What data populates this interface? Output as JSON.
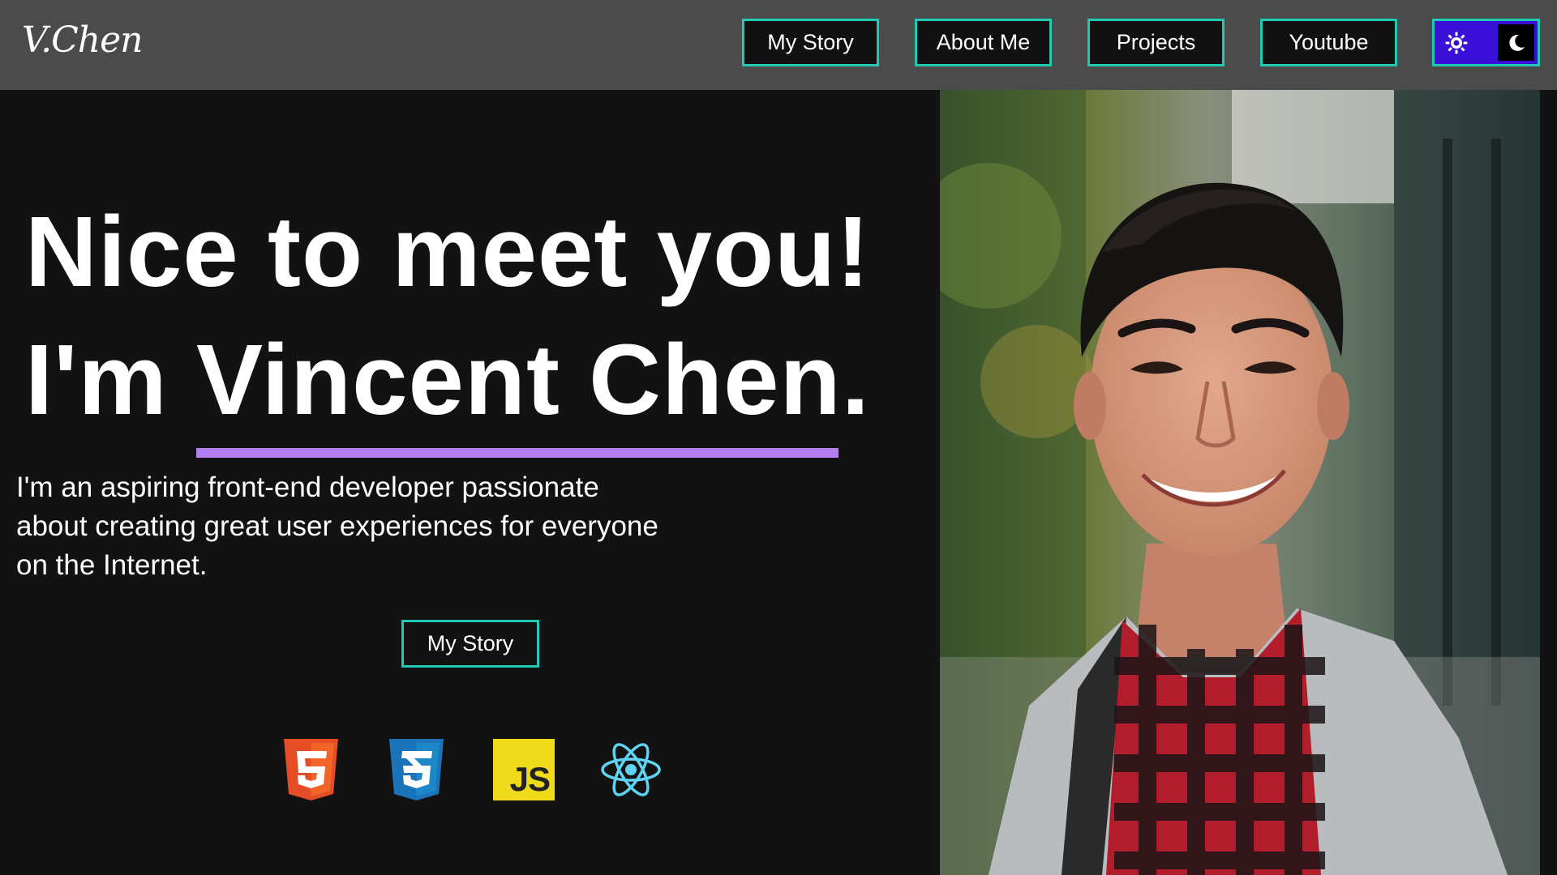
{
  "header": {
    "logo": "V.Chen",
    "nav": [
      {
        "label": "My Story"
      },
      {
        "label": "About Me"
      },
      {
        "label": "Projects"
      },
      {
        "label": "Youtube"
      }
    ],
    "theme_toggle": {
      "light_icon": "sun-icon",
      "dark_icon": "moon-icon",
      "state": "dark"
    }
  },
  "hero": {
    "line1": "Nice to meet you!",
    "line2_prefix": "I'm ",
    "name": "Vincent Chen",
    "line2_suffix": ".",
    "intro": "I'm an aspiring front-end developer passionate about creating great user experiences for everyone on the Internet.",
    "cta": "My Story"
  },
  "tech_icons": [
    "html5-icon",
    "css3-icon",
    "javascript-icon",
    "react-icon"
  ],
  "tech_badges": {
    "js": "JS",
    "html": "5",
    "css": "3"
  },
  "colors": {
    "accent": "#1fc9b3",
    "underline": "#b67cf1",
    "header_bg": "#4b4b4b",
    "page_bg": "#121212",
    "toggle_bg": "#3a10d8"
  }
}
